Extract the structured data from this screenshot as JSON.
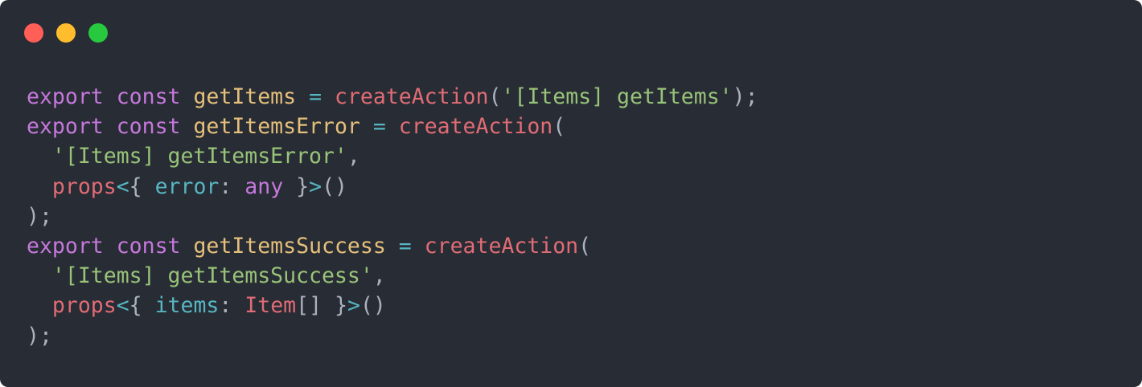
{
  "window": {
    "background": "#282c34",
    "controls": [
      {
        "name": "close",
        "color": "#ff5f56"
      },
      {
        "name": "minimize",
        "color": "#ffbd2e"
      },
      {
        "name": "zoom",
        "color": "#27c93f"
      }
    ]
  },
  "theme": {
    "keyword": "#c678dd",
    "function_name": "#e5c07b",
    "operator": "#56b6c2",
    "call": "#e06c75",
    "string": "#98c379",
    "plain": "#abb2bf",
    "property": "#56b6c2",
    "type": "#e06c75"
  },
  "code": {
    "lines": [
      [
        {
          "t": "export",
          "k": "keyword"
        },
        {
          "t": " ",
          "k": "plain"
        },
        {
          "t": "const",
          "k": "keyword"
        },
        {
          "t": " ",
          "k": "plain"
        },
        {
          "t": "getItems",
          "k": "function_name"
        },
        {
          "t": " ",
          "k": "plain"
        },
        {
          "t": "=",
          "k": "operator"
        },
        {
          "t": " ",
          "k": "plain"
        },
        {
          "t": "createAction",
          "k": "call"
        },
        {
          "t": "(",
          "k": "plain"
        },
        {
          "t": "'[Items] getItems'",
          "k": "string"
        },
        {
          "t": ");",
          "k": "plain"
        }
      ],
      [
        {
          "t": "export",
          "k": "keyword"
        },
        {
          "t": " ",
          "k": "plain"
        },
        {
          "t": "const",
          "k": "keyword"
        },
        {
          "t": " ",
          "k": "plain"
        },
        {
          "t": "getItemsError",
          "k": "function_name"
        },
        {
          "t": " ",
          "k": "plain"
        },
        {
          "t": "=",
          "k": "operator"
        },
        {
          "t": " ",
          "k": "plain"
        },
        {
          "t": "createAction",
          "k": "call"
        },
        {
          "t": "(",
          "k": "plain"
        }
      ],
      [
        {
          "t": "  ",
          "k": "plain"
        },
        {
          "t": "'[Items] getItemsError'",
          "k": "string"
        },
        {
          "t": ",",
          "k": "plain"
        }
      ],
      [
        {
          "t": "  ",
          "k": "plain"
        },
        {
          "t": "props",
          "k": "call"
        },
        {
          "t": "<",
          "k": "operator"
        },
        {
          "t": "{ ",
          "k": "plain"
        },
        {
          "t": "error",
          "k": "property"
        },
        {
          "t": ": ",
          "k": "plain"
        },
        {
          "t": "any",
          "k": "keyword"
        },
        {
          "t": " }",
          "k": "plain"
        },
        {
          "t": ">",
          "k": "operator"
        },
        {
          "t": "()",
          "k": "plain"
        }
      ],
      [
        {
          "t": ");",
          "k": "plain"
        }
      ],
      [
        {
          "t": "export",
          "k": "keyword"
        },
        {
          "t": " ",
          "k": "plain"
        },
        {
          "t": "const",
          "k": "keyword"
        },
        {
          "t": " ",
          "k": "plain"
        },
        {
          "t": "getItemsSuccess",
          "k": "function_name"
        },
        {
          "t": " ",
          "k": "plain"
        },
        {
          "t": "=",
          "k": "operator"
        },
        {
          "t": " ",
          "k": "plain"
        },
        {
          "t": "createAction",
          "k": "call"
        },
        {
          "t": "(",
          "k": "plain"
        }
      ],
      [
        {
          "t": "  ",
          "k": "plain"
        },
        {
          "t": "'[Items] getItemsSuccess'",
          "k": "string"
        },
        {
          "t": ",",
          "k": "plain"
        }
      ],
      [
        {
          "t": "  ",
          "k": "plain"
        },
        {
          "t": "props",
          "k": "call"
        },
        {
          "t": "<",
          "k": "operator"
        },
        {
          "t": "{ ",
          "k": "plain"
        },
        {
          "t": "items",
          "k": "property"
        },
        {
          "t": ": ",
          "k": "plain"
        },
        {
          "t": "Item",
          "k": "type"
        },
        {
          "t": "[]",
          "k": "plain"
        },
        {
          "t": " }",
          "k": "plain"
        },
        {
          "t": ">",
          "k": "operator"
        },
        {
          "t": "()",
          "k": "plain"
        }
      ],
      [
        {
          "t": ");",
          "k": "plain"
        }
      ]
    ]
  }
}
